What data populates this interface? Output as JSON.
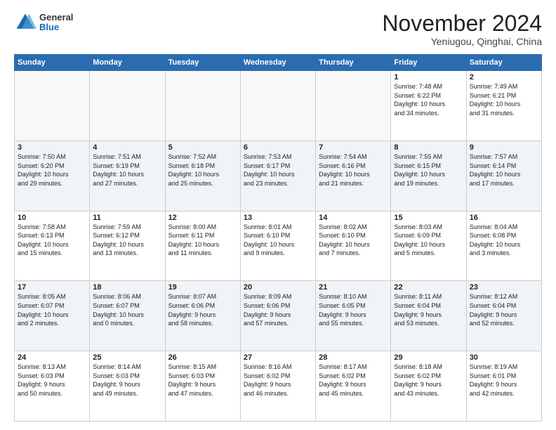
{
  "logo": {
    "general": "General",
    "blue": "Blue"
  },
  "header": {
    "month": "November 2024",
    "location": "Yeniugou, Qinghai, China"
  },
  "weekdays": [
    "Sunday",
    "Monday",
    "Tuesday",
    "Wednesday",
    "Thursday",
    "Friday",
    "Saturday"
  ],
  "weeks": [
    [
      {
        "day": "",
        "info": ""
      },
      {
        "day": "",
        "info": ""
      },
      {
        "day": "",
        "info": ""
      },
      {
        "day": "",
        "info": ""
      },
      {
        "day": "",
        "info": ""
      },
      {
        "day": "1",
        "info": "Sunrise: 7:48 AM\nSunset: 6:22 PM\nDaylight: 10 hours\nand 34 minutes."
      },
      {
        "day": "2",
        "info": "Sunrise: 7:49 AM\nSunset: 6:21 PM\nDaylight: 10 hours\nand 31 minutes."
      }
    ],
    [
      {
        "day": "3",
        "info": "Sunrise: 7:50 AM\nSunset: 6:20 PM\nDaylight: 10 hours\nand 29 minutes."
      },
      {
        "day": "4",
        "info": "Sunrise: 7:51 AM\nSunset: 6:19 PM\nDaylight: 10 hours\nand 27 minutes."
      },
      {
        "day": "5",
        "info": "Sunrise: 7:52 AM\nSunset: 6:18 PM\nDaylight: 10 hours\nand 25 minutes."
      },
      {
        "day": "6",
        "info": "Sunrise: 7:53 AM\nSunset: 6:17 PM\nDaylight: 10 hours\nand 23 minutes."
      },
      {
        "day": "7",
        "info": "Sunrise: 7:54 AM\nSunset: 6:16 PM\nDaylight: 10 hours\nand 21 minutes."
      },
      {
        "day": "8",
        "info": "Sunrise: 7:55 AM\nSunset: 6:15 PM\nDaylight: 10 hours\nand 19 minutes."
      },
      {
        "day": "9",
        "info": "Sunrise: 7:57 AM\nSunset: 6:14 PM\nDaylight: 10 hours\nand 17 minutes."
      }
    ],
    [
      {
        "day": "10",
        "info": "Sunrise: 7:58 AM\nSunset: 6:13 PM\nDaylight: 10 hours\nand 15 minutes."
      },
      {
        "day": "11",
        "info": "Sunrise: 7:59 AM\nSunset: 6:12 PM\nDaylight: 10 hours\nand 13 minutes."
      },
      {
        "day": "12",
        "info": "Sunrise: 8:00 AM\nSunset: 6:11 PM\nDaylight: 10 hours\nand 11 minutes."
      },
      {
        "day": "13",
        "info": "Sunrise: 8:01 AM\nSunset: 6:10 PM\nDaylight: 10 hours\nand 9 minutes."
      },
      {
        "day": "14",
        "info": "Sunrise: 8:02 AM\nSunset: 6:10 PM\nDaylight: 10 hours\nand 7 minutes."
      },
      {
        "day": "15",
        "info": "Sunrise: 8:03 AM\nSunset: 6:09 PM\nDaylight: 10 hours\nand 5 minutes."
      },
      {
        "day": "16",
        "info": "Sunrise: 8:04 AM\nSunset: 6:08 PM\nDaylight: 10 hours\nand 3 minutes."
      }
    ],
    [
      {
        "day": "17",
        "info": "Sunrise: 8:05 AM\nSunset: 6:07 PM\nDaylight: 10 hours\nand 2 minutes."
      },
      {
        "day": "18",
        "info": "Sunrise: 8:06 AM\nSunset: 6:07 PM\nDaylight: 10 hours\nand 0 minutes."
      },
      {
        "day": "19",
        "info": "Sunrise: 8:07 AM\nSunset: 6:06 PM\nDaylight: 9 hours\nand 58 minutes."
      },
      {
        "day": "20",
        "info": "Sunrise: 8:09 AM\nSunset: 6:06 PM\nDaylight: 9 hours\nand 57 minutes."
      },
      {
        "day": "21",
        "info": "Sunrise: 8:10 AM\nSunset: 6:05 PM\nDaylight: 9 hours\nand 55 minutes."
      },
      {
        "day": "22",
        "info": "Sunrise: 8:11 AM\nSunset: 6:04 PM\nDaylight: 9 hours\nand 53 minutes."
      },
      {
        "day": "23",
        "info": "Sunrise: 8:12 AM\nSunset: 6:04 PM\nDaylight: 9 hours\nand 52 minutes."
      }
    ],
    [
      {
        "day": "24",
        "info": "Sunrise: 8:13 AM\nSunset: 6:03 PM\nDaylight: 9 hours\nand 50 minutes."
      },
      {
        "day": "25",
        "info": "Sunrise: 8:14 AM\nSunset: 6:03 PM\nDaylight: 9 hours\nand 49 minutes."
      },
      {
        "day": "26",
        "info": "Sunrise: 8:15 AM\nSunset: 6:03 PM\nDaylight: 9 hours\nand 47 minutes."
      },
      {
        "day": "27",
        "info": "Sunrise: 8:16 AM\nSunset: 6:02 PM\nDaylight: 9 hours\nand 46 minutes."
      },
      {
        "day": "28",
        "info": "Sunrise: 8:17 AM\nSunset: 6:02 PM\nDaylight: 9 hours\nand 45 minutes."
      },
      {
        "day": "29",
        "info": "Sunrise: 8:18 AM\nSunset: 6:02 PM\nDaylight: 9 hours\nand 43 minutes."
      },
      {
        "day": "30",
        "info": "Sunrise: 8:19 AM\nSunset: 6:01 PM\nDaylight: 9 hours\nand 42 minutes."
      }
    ]
  ]
}
